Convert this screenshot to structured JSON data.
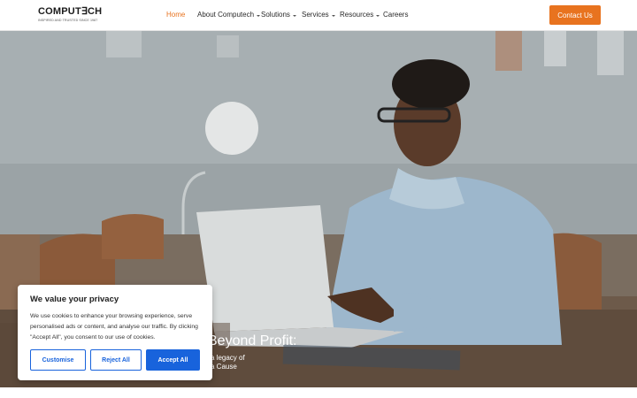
{
  "header": {
    "logo": {
      "name": "COMPUT∃CH",
      "tagline": "INSPIRED AND TRUSTED SINCE 1987"
    },
    "nav": [
      {
        "label": "Home",
        "active": true,
        "has_dropdown": false
      },
      {
        "label": "About Computech",
        "active": false,
        "has_dropdown": true
      },
      {
        "label": "Solutions",
        "active": false,
        "has_dropdown": true
      },
      {
        "label": "Services",
        "active": false,
        "has_dropdown": true
      },
      {
        "label": "Resources",
        "active": false,
        "has_dropdown": true
      },
      {
        "label": "Careers",
        "active": false,
        "has_dropdown": false
      }
    ],
    "contact_label": "Contact Us"
  },
  "hero": {
    "headline": "Beyond Profit:",
    "sub_line1": "a legacy of",
    "sub_line2": "a Cause"
  },
  "cookie": {
    "title": "We value your privacy",
    "text": "We use cookies to enhance your browsing experience, serve personalised ads or content, and analyse our traffic. By clicking \"Accept All\", you consent to our use of cookies.",
    "customise_label": "Customise",
    "reject_label": "Reject All",
    "accept_label": "Accept All"
  },
  "colors": {
    "accent": "#e8731f",
    "cookie_blue": "#1863dc"
  }
}
